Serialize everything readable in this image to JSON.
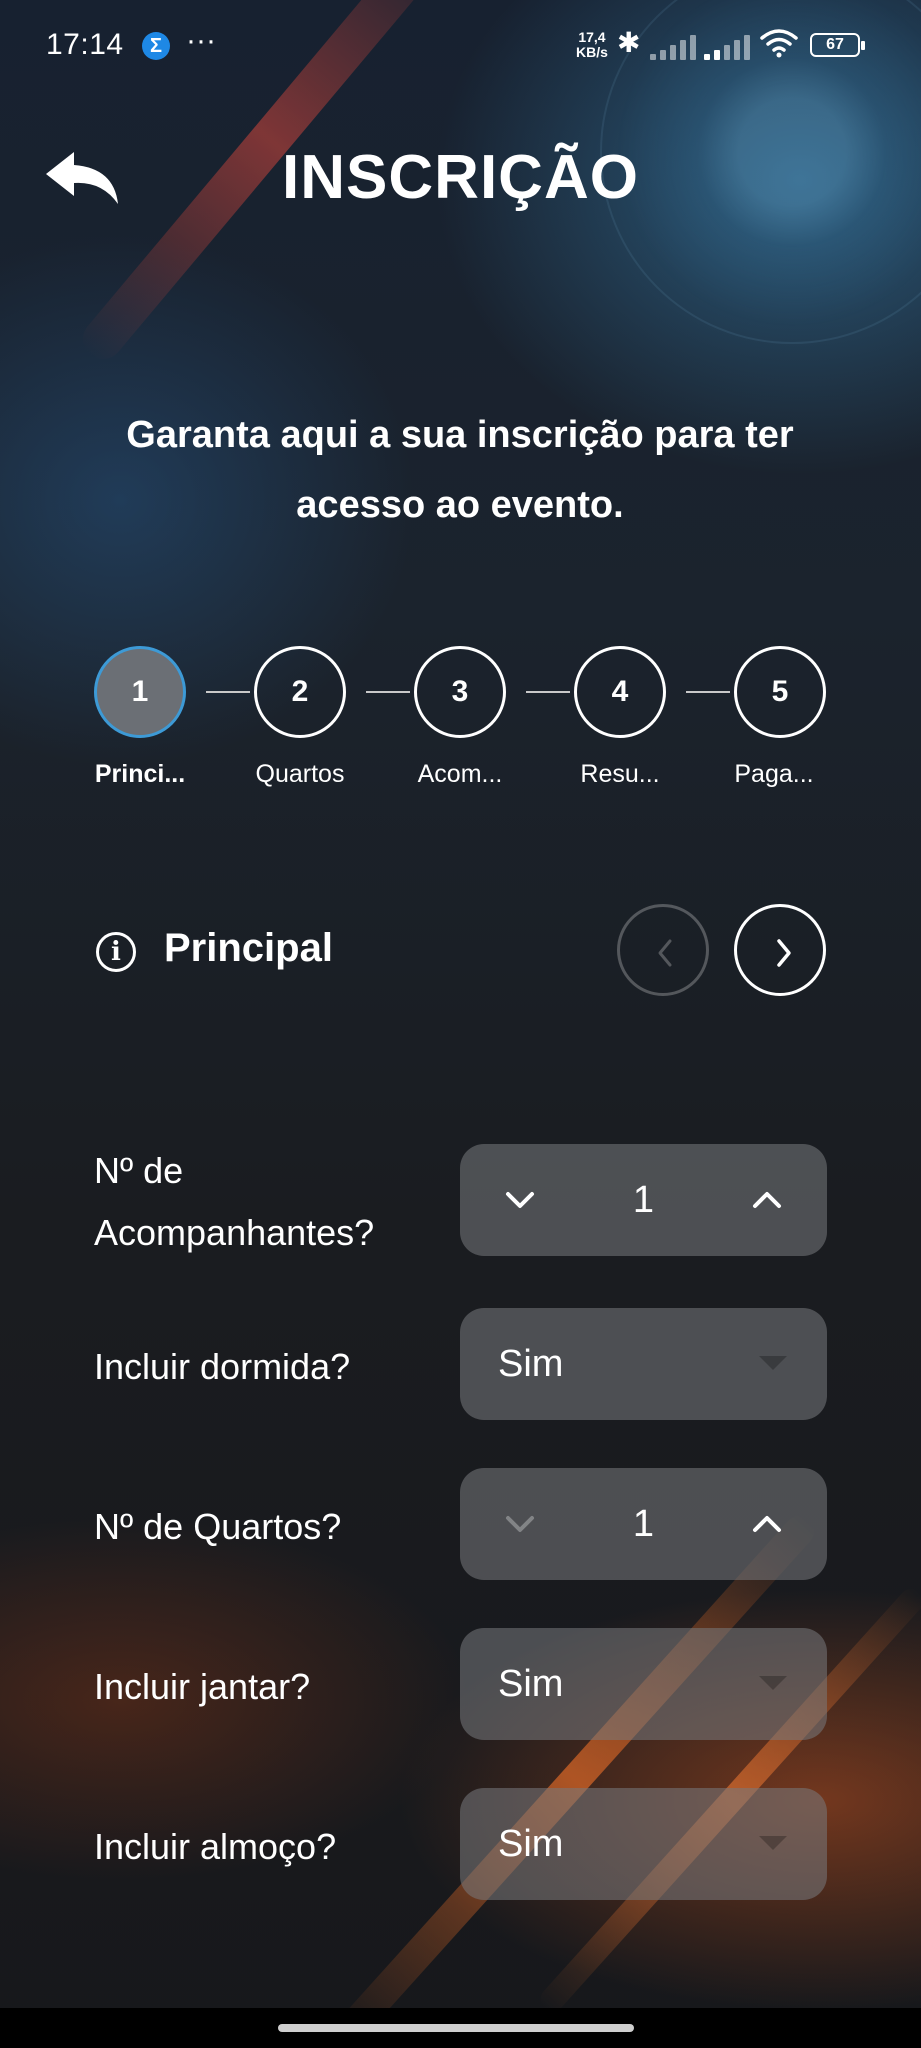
{
  "status_bar": {
    "time": "17:14",
    "notification_icon": "Σ",
    "more": "···",
    "net_speed_value": "17,4",
    "net_speed_unit": "KB/s",
    "battery": "67"
  },
  "header": {
    "title": "INSCRIÇÃO",
    "subtitle_line1": "Garanta aqui a sua inscrição para ter",
    "subtitle_line2": "acesso ao evento."
  },
  "steps": [
    {
      "number": "1",
      "label": "Princi..."
    },
    {
      "number": "2",
      "label": "Quartos"
    },
    {
      "number": "3",
      "label": "Acom..."
    },
    {
      "number": "4",
      "label": "Resu..."
    },
    {
      "number": "5",
      "label": "Paga..."
    }
  ],
  "section": {
    "title": "Principal",
    "icon": "info-icon"
  },
  "form": {
    "acompanhantes": {
      "label_line1": "Nº de",
      "label_line2": "Acompanhantes?",
      "value": "1"
    },
    "dormida": {
      "label": "Incluir dormida?",
      "value": "Sim"
    },
    "quartos": {
      "label": "Nº de Quartos?",
      "value": "1"
    },
    "jantar": {
      "label": "Incluir jantar?",
      "value": "Sim"
    },
    "almoco": {
      "label": "Incluir almoço?",
      "value": "Sim"
    }
  },
  "colors": {
    "active_step_border": "#3d9ad6",
    "active_step_fill": "#6b6f75",
    "field_bg": "#7a7c80"
  }
}
